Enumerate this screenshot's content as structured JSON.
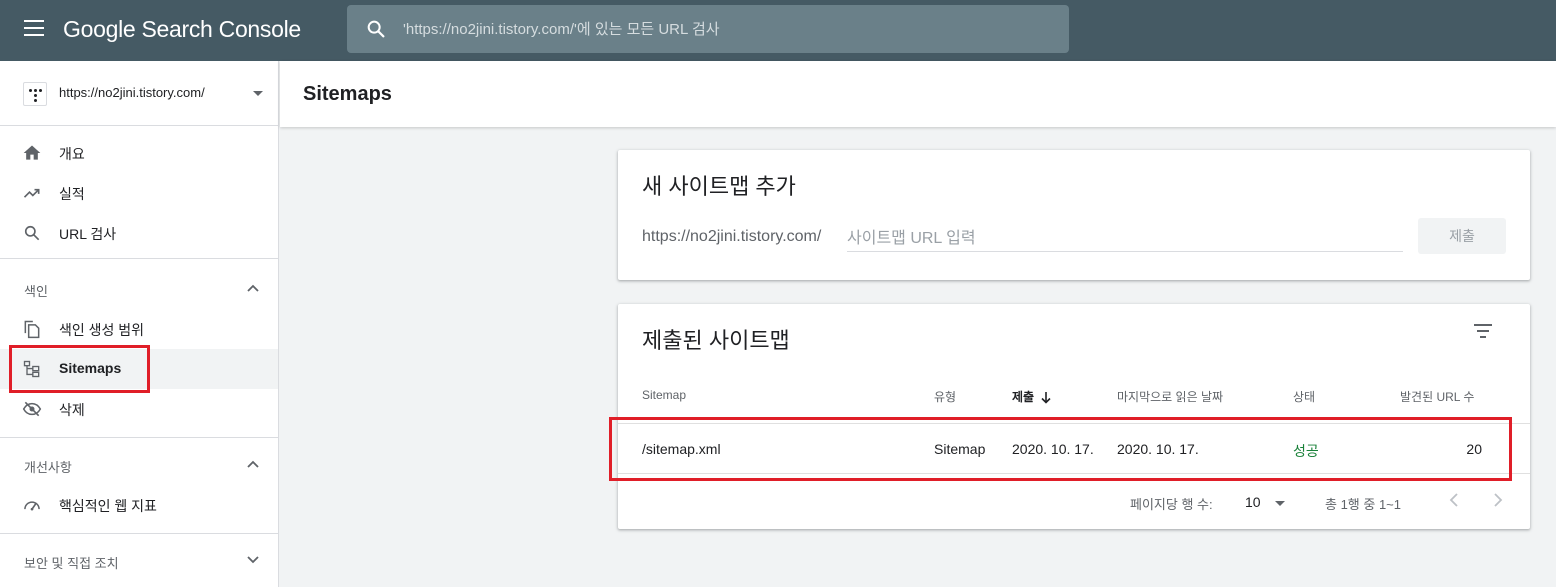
{
  "topbar": {
    "logo_google": "Google",
    "logo_product": " Search Console",
    "search_placeholder": "'https://no2jini.tistory.com/'에 있는 모든 URL 검사"
  },
  "sidebar": {
    "property_url": "https://no2jini.tistory.com/",
    "items": {
      "overview": "개요",
      "performance": "실적",
      "url_inspection": "URL 검사",
      "coverage": "색인 생성 범위",
      "sitemaps": "Sitemaps",
      "removals": "삭제",
      "core_web_vitals": "핵심적인 웹 지표"
    },
    "sections": {
      "index": "색인",
      "enhancements": "개선사항",
      "security": "보안 및 직접 조치"
    }
  },
  "header": {
    "title": "Sitemaps"
  },
  "add_card": {
    "title": "새 사이트맵 추가",
    "prefix": "https://no2jini.tistory.com/",
    "input_placeholder": "사이트맵 URL 입력",
    "submit_label": "제출"
  },
  "submitted_card": {
    "title": "제출된 사이트맵",
    "columns": {
      "sitemap": "Sitemap",
      "type": "유형",
      "submitted": "제출",
      "last_read": "마지막으로 읽은 날짜",
      "status": "상태",
      "discovered": "발견된 URL 수"
    },
    "rows": [
      {
        "sitemap": "/sitemap.xml",
        "type": "Sitemap",
        "submitted": "2020. 10. 17.",
        "last_read": "2020. 10. 17.",
        "status": "성공",
        "discovered": "20"
      }
    ],
    "pagination": {
      "rows_per_page_label": "페이지당 행 수:",
      "rows_per_page": "10",
      "range_text": "총 1행 중 1~1"
    }
  },
  "colors": {
    "topbar": "#455a64",
    "highlight": "#e01e28",
    "success": "#188038"
  }
}
